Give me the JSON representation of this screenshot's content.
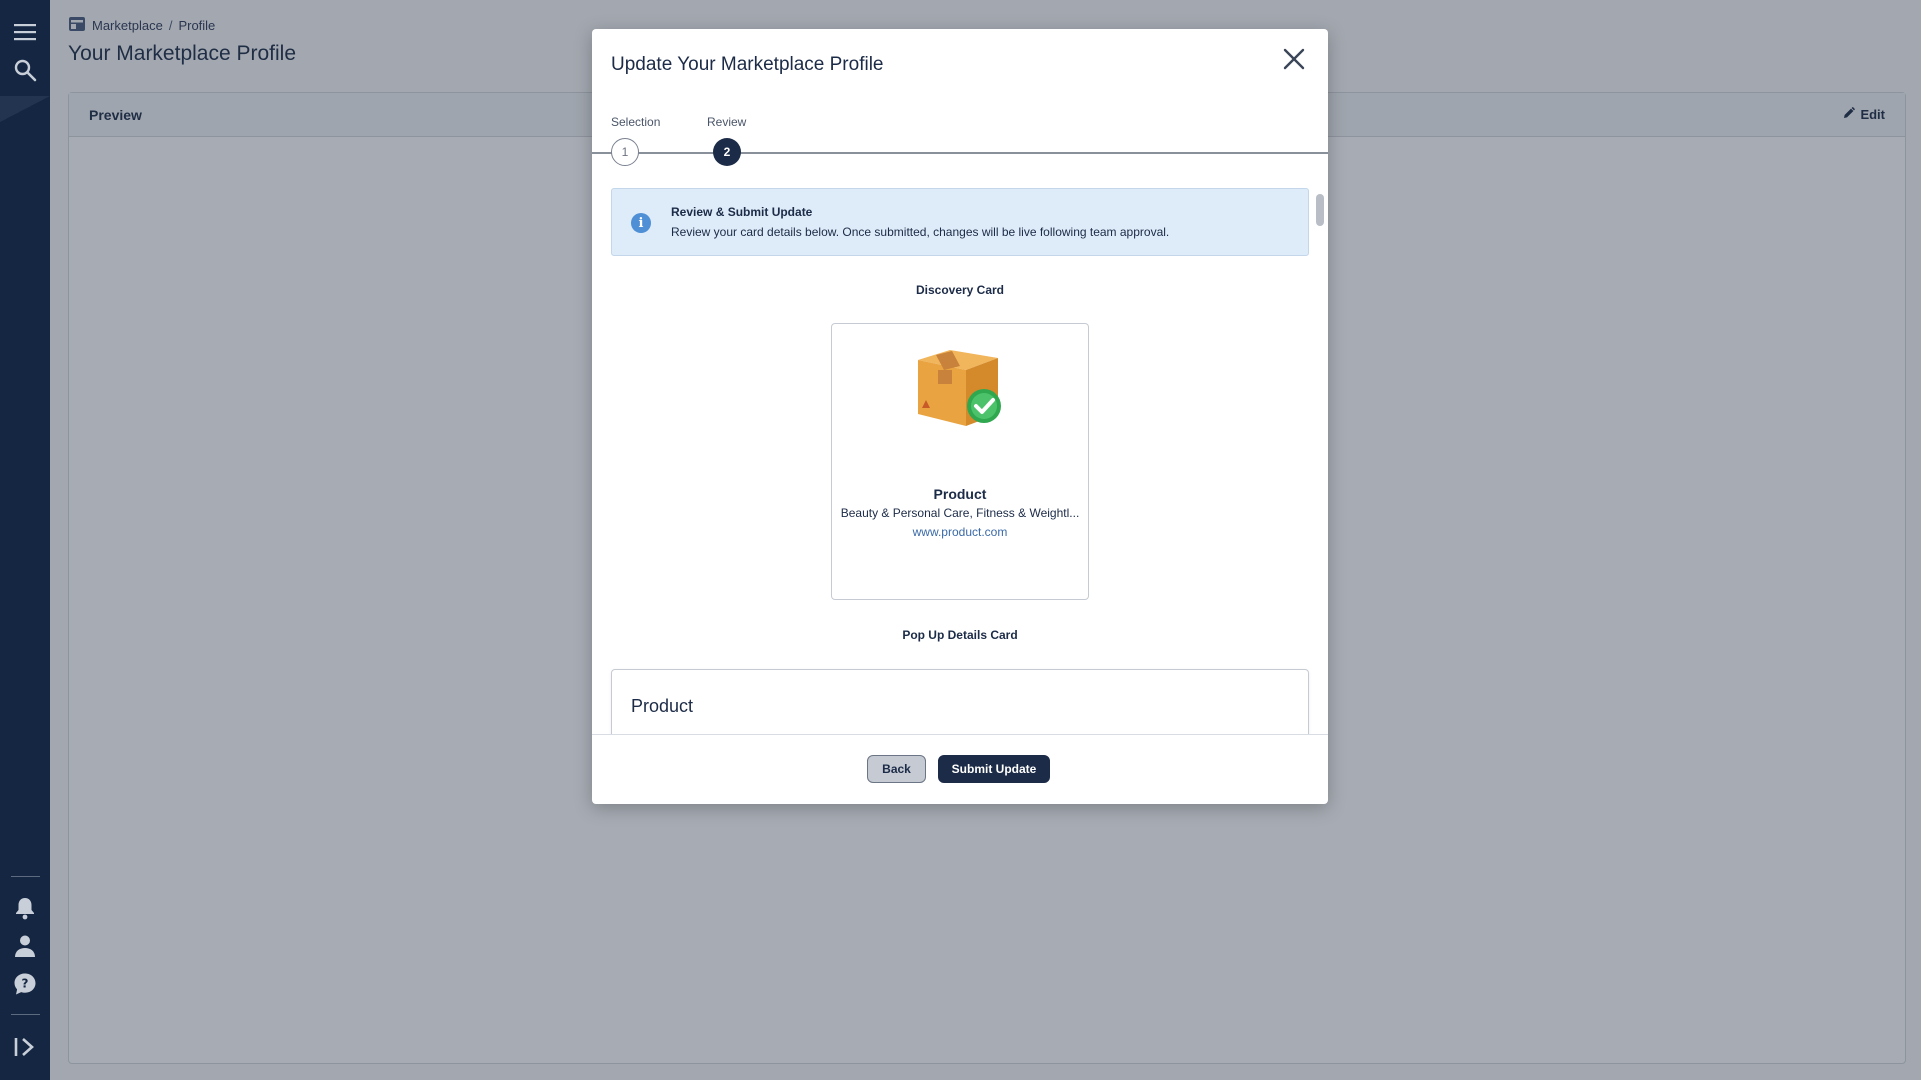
{
  "sidebar": {
    "top_icons": [
      "menu-icon",
      "search-icon"
    ],
    "bottom_icons": [
      "bell-icon",
      "user-icon",
      "help-icon",
      "expand-icon"
    ]
  },
  "breadcrumb": {
    "items": [
      "Marketplace",
      "Profile"
    ],
    "separator": "/"
  },
  "page": {
    "title": "Your Marketplace Profile",
    "panel_label": "Preview",
    "edit_label": "Edit"
  },
  "modal": {
    "title": "Update Your Marketplace Profile",
    "steps": [
      {
        "label": "Selection",
        "number": "1",
        "state": "done"
      },
      {
        "label": "Review",
        "number": "2",
        "state": "active"
      }
    ],
    "info": {
      "title": "Review & Submit Update",
      "text": "Review your card details below. Once submitted, changes will be live following team approval."
    },
    "discovery_section_label": "Discovery Card",
    "discovery_card": {
      "name": "Product",
      "categories": "Beauty & Personal Care, Fitness & Weightl...",
      "url": "www.product.com",
      "image_icon": "package-check-icon"
    },
    "popup_section_label": "Pop Up Details Card",
    "popup_card": {
      "name": "Product"
    },
    "buttons": {
      "back": "Back",
      "submit": "Submit Update"
    }
  },
  "colors": {
    "primary": "#1c2b47",
    "sidebar": "#142642",
    "info_bg": "#deebf8",
    "info_icon": "#4f8fd6",
    "link": "#3a6aa8"
  }
}
